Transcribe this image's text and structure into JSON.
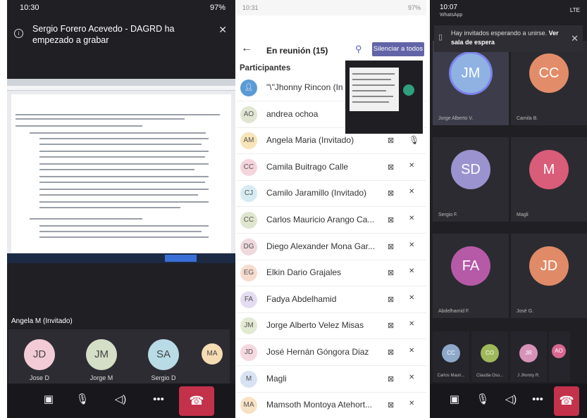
{
  "left": {
    "time": "10:30",
    "status_right": "97%",
    "notification": "Sergio Forero Acevedo - DAGRD ha empezado a grabar",
    "presenter_label": "Angela M (Invitado)",
    "tiles": [
      {
        "initials": "JD",
        "name": "Jose D",
        "color": "#f3cbd6"
      },
      {
        "initials": "JM",
        "name": "Jorge M",
        "color": "#d5dec6"
      },
      {
        "initials": "SA",
        "name": "Sergio D",
        "color": "#b8dbe6"
      },
      {
        "initials": "MA",
        "name": "",
        "color": "#f5dcb3"
      }
    ]
  },
  "middle": {
    "time": "10:31",
    "status_right": "97%",
    "title": "En reunión (15)",
    "mute_all": "Silenciar a todos",
    "participants_label": "Participantes",
    "participants": [
      {
        "initials": "",
        "name": "\"\\\"Jhonny Rincon (In",
        "color": "#5a9bd5",
        "icon": true
      },
      {
        "initials": "AO",
        "name": "andrea ochoa",
        "color": "#e1e6d2"
      },
      {
        "initials": "AM",
        "name": "Angela Maria (Invitado)",
        "color": "#f7e4b8"
      },
      {
        "initials": "CC",
        "name": "Camila Buitrago Calle",
        "color": "#f6d4dc"
      },
      {
        "initials": "CJ",
        "name": "Camilo Jaramillo (Invitado)",
        "color": "#d6ebf2"
      },
      {
        "initials": "CC",
        "name": "Carlos Mauricio Arango Ca...",
        "color": "#dfe6cf"
      },
      {
        "initials": "DG",
        "name": "Diego Alexander Mona Gar...",
        "color": "#efd9dd"
      },
      {
        "initials": "EG",
        "name": "Elkin Dario Grajales",
        "color": "#f7dccd"
      },
      {
        "initials": "FA",
        "name": "Fadya Abdelhamid",
        "color": "#e4dcf0"
      },
      {
        "initials": "JM",
        "name": "Jorge Alberto Velez Misas",
        "color": "#e2ead4"
      },
      {
        "initials": "JD",
        "name": "José Hernán Góngora Diaz",
        "color": "#f6d8e0"
      },
      {
        "initials": "M",
        "name": "Magli",
        "color": "#d7e3f3"
      },
      {
        "initials": "MA",
        "name": "Mamsoth Montoya Atehort...",
        "color": "#f8e2c4"
      }
    ]
  },
  "right": {
    "time": "10:07",
    "app": "WhatsApp",
    "status_right": "LTE",
    "banner_text": "Hay invitados esperando a unirse.",
    "banner_link": "Ver sala de espera",
    "grid": [
      {
        "initials": "JM",
        "name": "Jorge Alberto V.",
        "color": "#8fb2e3"
      },
      {
        "initials": "CC",
        "name": "Camila B.",
        "color": "#e38c6a"
      },
      {
        "initials": "SD",
        "name": "Sergio F.",
        "color": "#9a93cf"
      },
      {
        "initials": "M",
        "name": "Magli",
        "color": "#d95c79"
      },
      {
        "initials": "FA",
        "name": "Abdelhamid F.",
        "color": "#b65aa8"
      },
      {
        "initials": "JD",
        "name": "José G.",
        "color": "#e08a68"
      }
    ],
    "small": [
      {
        "initials": "CC",
        "name": "Carlos Mauri...",
        "color": "#8ea8c9"
      },
      {
        "initials": "CO",
        "name": "Claudia Oso...",
        "color": "#9fb85a"
      },
      {
        "initials": "JR",
        "name": "J Jhonny R.",
        "color": "#d792b8"
      },
      {
        "initials": "AO",
        "name": "",
        "color": "#d96891"
      }
    ]
  }
}
